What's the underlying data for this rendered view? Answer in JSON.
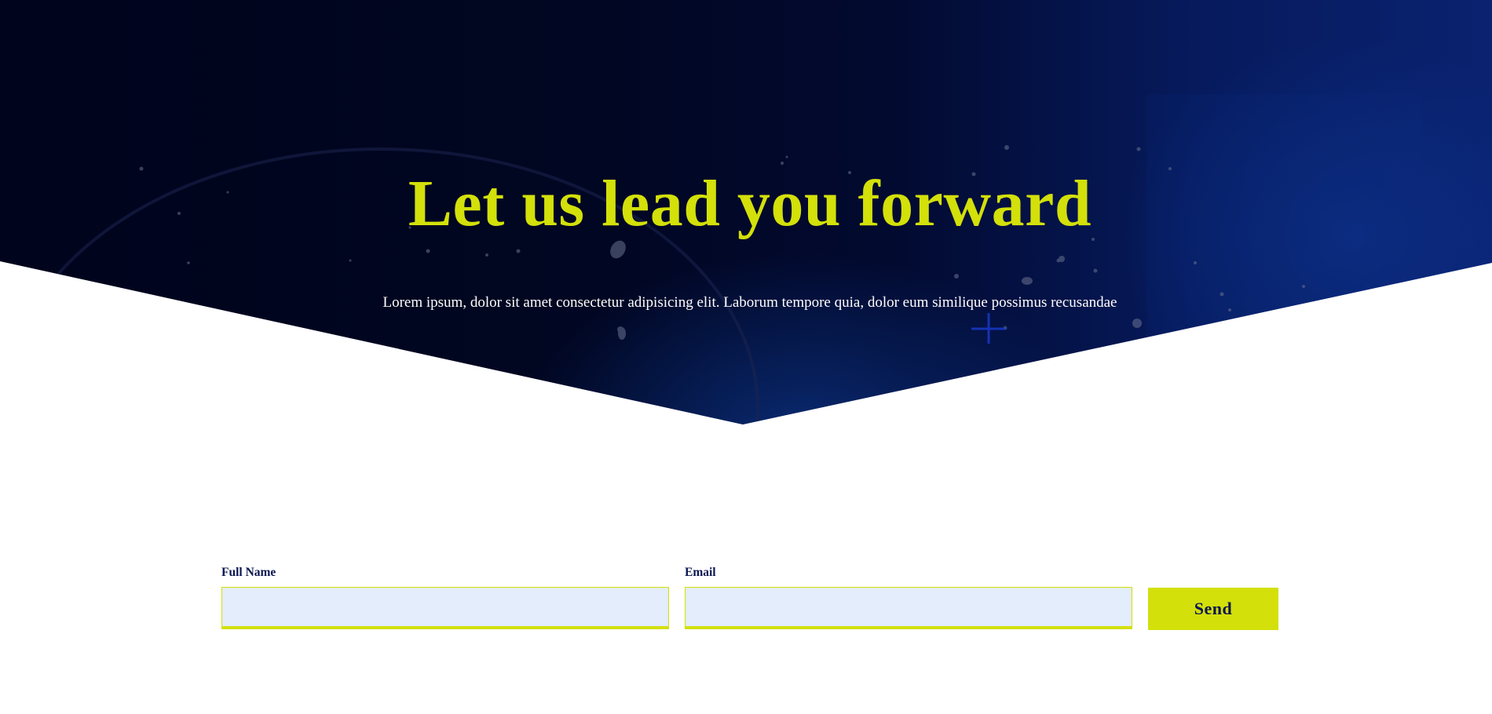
{
  "hero": {
    "title": "Let us lead you forward",
    "subtitle": "Lorem ipsum, dolor sit amet consectetur adipisicing elit. Laborum tempore quia, dolor eum similique possimus recusandae"
  },
  "form": {
    "full_name": {
      "label": "Full Name",
      "value": "",
      "placeholder": ""
    },
    "email": {
      "label": "Email",
      "value": "",
      "placeholder": ""
    },
    "send_label": "Send"
  },
  "colors": {
    "accent": "#d3e00a",
    "navy": "#00041c",
    "text_dark": "#0a1650",
    "input_bg": "#e3edfb"
  },
  "icons": {
    "hero_decoration": "plus-icon"
  }
}
